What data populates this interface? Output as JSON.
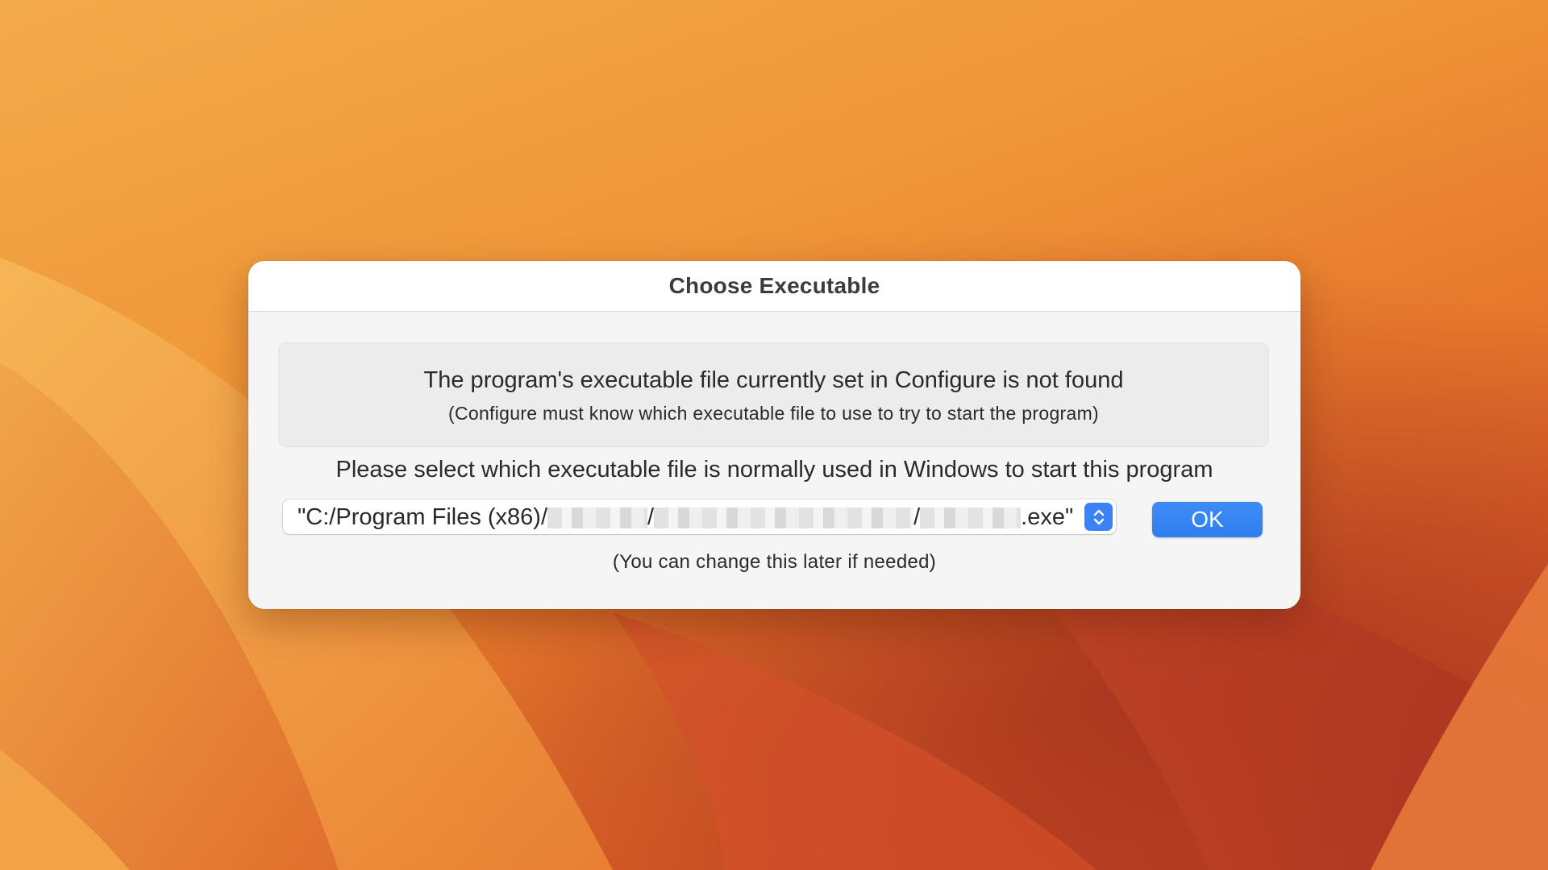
{
  "dialog": {
    "title": "Choose Executable",
    "message_main": "The program's executable file currently set in Configure is not found",
    "message_sub": "(Configure must know which executable file to use to try to start the program)",
    "instruction": "Please select which executable file is normally used in Windows to start this program",
    "path_select": {
      "prefix": "\"C:/Program Files (x86)/",
      "sep1": "/",
      "sep2": "/",
      "suffix": ".exe\"",
      "stepper_icon": "chevron-up-down-icon"
    },
    "ok_label": "OK",
    "hint": "(You can change this later if needed)"
  },
  "colors": {
    "accent": "#3b82f6",
    "wallpaper_primary": "#ef9638",
    "wallpaper_dark": "#c0402a"
  }
}
